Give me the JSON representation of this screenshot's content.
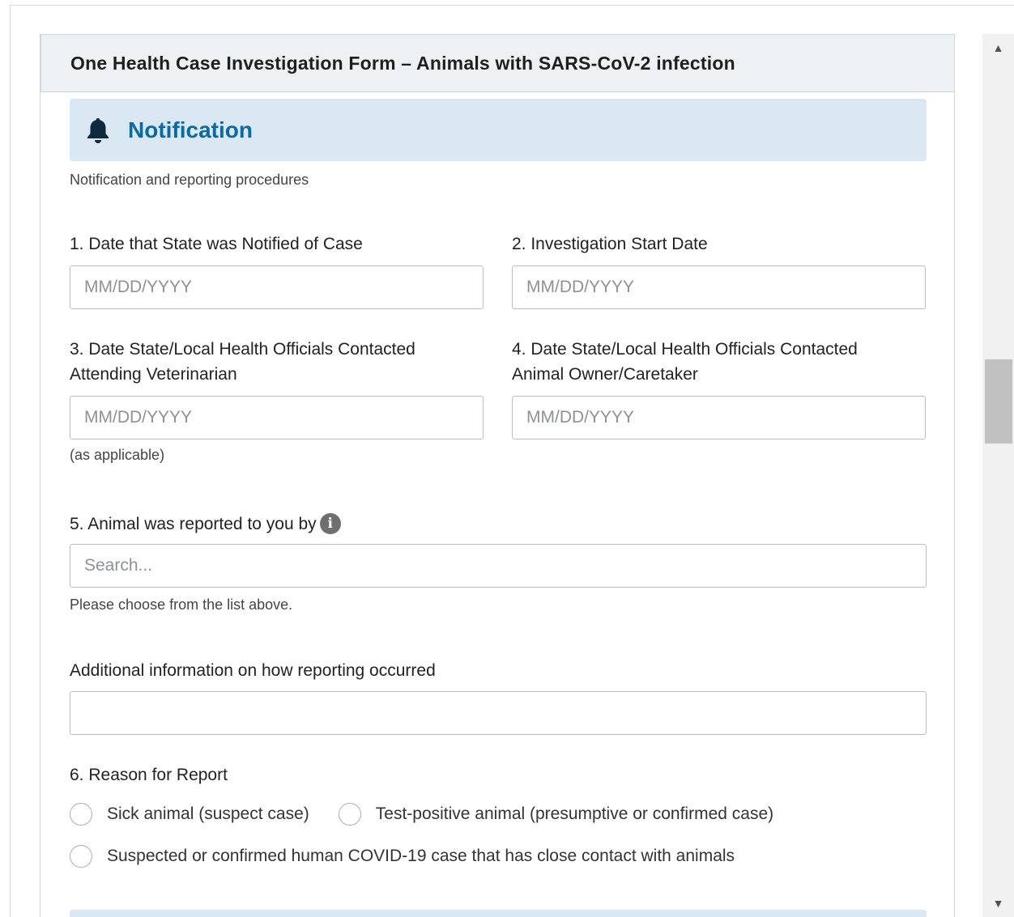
{
  "form": {
    "title": "One Health Case Investigation Form – Animals with SARS-CoV-2 infection"
  },
  "section": {
    "icon": "bell-icon",
    "title": "Notification",
    "description": "Notification and reporting procedures"
  },
  "fields": {
    "q1": {
      "label": "1. Date that State was Notified of Case",
      "placeholder": "MM/DD/YYYY",
      "value": ""
    },
    "q2": {
      "label": "2. Investigation Start Date",
      "placeholder": "MM/DD/YYYY",
      "value": ""
    },
    "q3": {
      "label_line1": "3. Date State/Local Health Officials Contacted",
      "label_line2": "Attending Veterinarian",
      "placeholder": "MM/DD/YYYY",
      "value": "",
      "help": "(as applicable)"
    },
    "q4": {
      "label_line1": "4. Date State/Local Health Officials Contacted",
      "label_line2": "Animal Owner/Caretaker",
      "placeholder": "MM/DD/YYYY",
      "value": ""
    },
    "q5": {
      "label": "5. Animal was reported to you by",
      "info_icon": "info-icon",
      "info_glyph": "i",
      "placeholder": "Search...",
      "value": "",
      "help": "Please choose from the list above."
    },
    "additional": {
      "label": "Additional information on how reporting occurred",
      "value": ""
    },
    "q6": {
      "label": "6. Reason for Report",
      "options": [
        "Sick animal (suspect case)",
        "Test-positive animal (presumptive or confirmed case)",
        "Suspected or confirmed human COVID-19 case that has close contact with animals"
      ]
    }
  },
  "scrollbar": {
    "up_glyph": "▲",
    "down_glyph": "▼"
  },
  "colors": {
    "section_banner_bg": "#d9e8f3",
    "section_title": "#0a6aa1",
    "header_bg": "#edf1f4"
  }
}
